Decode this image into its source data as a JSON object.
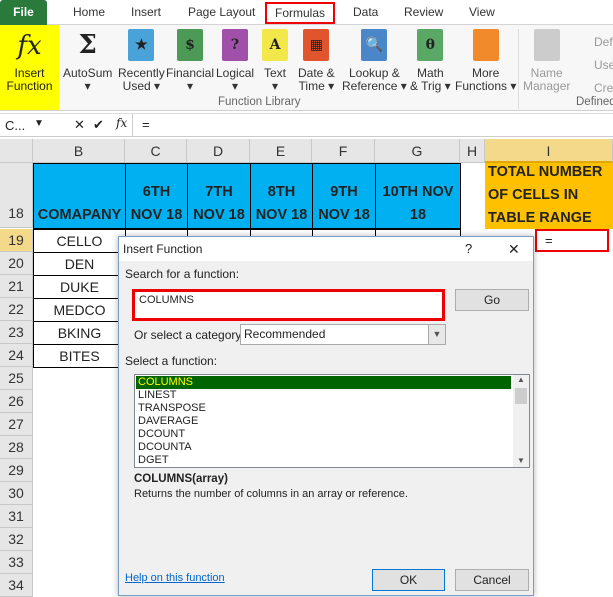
{
  "ribbon_tabs": [
    "File",
    "Home",
    "Insert",
    "Page Layout",
    "Formulas",
    "Data",
    "Review",
    "View"
  ],
  "ribbon": {
    "insert_function": [
      "Insert",
      "Function"
    ],
    "buttons": [
      {
        "label": [
          "AutoSum",
          "▾"
        ],
        "icon": "sigma-icon",
        "glyph": "Σ",
        "color": "#f7f7f7"
      },
      {
        "label": [
          "Recently",
          "Used ▾"
        ],
        "icon": "star-book-icon",
        "glyph": "★",
        "color": "#4aa3d8"
      },
      {
        "label": [
          "Financial",
          "▾"
        ],
        "icon": "money-book-icon",
        "glyph": "$",
        "color": "#4c9a55"
      },
      {
        "label": [
          "Logical",
          "▾"
        ],
        "icon": "question-book-icon",
        "glyph": "?",
        "color": "#a050a8"
      },
      {
        "label": [
          "Text",
          "▾"
        ],
        "icon": "text-book-icon",
        "glyph": "A",
        "color": "#f2e84a"
      },
      {
        "label": [
          "Date &",
          "Time ▾"
        ],
        "icon": "calendar-book-icon",
        "glyph": "▦",
        "color": "#e0552e"
      },
      {
        "label": [
          "Lookup &",
          "Reference ▾"
        ],
        "icon": "magnifier-book-icon",
        "glyph": "🔍",
        "color": "#4a86c8"
      },
      {
        "label": [
          "Math",
          "& Trig ▾"
        ],
        "icon": "theta-book-icon",
        "glyph": "θ",
        "color": "#5aa865"
      },
      {
        "label": [
          "More",
          "Functions ▾"
        ],
        "icon": "books-icon",
        "glyph": "",
        "color": "#f08a2a"
      }
    ],
    "name_manager": [
      "Name",
      "Manager"
    ],
    "defined_items": [
      "Def",
      "Use",
      "Cre"
    ],
    "group_function_library": "Function Library",
    "group_defined": "Defined"
  },
  "formula_bar": {
    "name_box": "C...",
    "value": "="
  },
  "columns": [
    "B",
    "C",
    "D",
    "E",
    "F",
    "G",
    "H",
    "I"
  ],
  "header_row": {
    "row": "18",
    "cells": [
      "COMAPANY",
      "6TH NOV 18",
      "7TH NOV 18",
      "8TH NOV 18",
      "9TH NOV 18",
      "10TH NOV 18",
      "",
      "TOTAL NUMBER OF CELLS IN TABLE RANGE"
    ]
  },
  "rows": [
    "19",
    "20",
    "21",
    "22",
    "23",
    "24",
    "25",
    "26",
    "27",
    "28",
    "29",
    "30",
    "31",
    "32",
    "33",
    "34"
  ],
  "companies": [
    "CELLO",
    "DEN",
    "DUKE",
    "MEDCO",
    "BKING",
    "BITES"
  ],
  "active_cell_value": "=",
  "dialog": {
    "title": "Insert Function",
    "help": "?",
    "close": "✕",
    "search_label": "Search for a function:",
    "search_value": "COLUMNS",
    "go": "Go",
    "category_label": "Or select a category:",
    "category": "Recommended",
    "select_label": "Select a function:",
    "functions": [
      "COLUMNS",
      "LINEST",
      "TRANSPOSE",
      "DAVERAGE",
      "DCOUNT",
      "DCOUNTA",
      "DGET"
    ],
    "selected": "COLUMNS",
    "signature": "COLUMNS(array)",
    "description": "Returns the number of columns in an array or reference.",
    "help_link": "Help on this function",
    "ok": "OK",
    "cancel": "Cancel"
  },
  "colors": {
    "highlight": "#ff0000",
    "header_blue": "#00b0f0",
    "header_orange": "#ffc000",
    "selection_green": "#006400"
  }
}
